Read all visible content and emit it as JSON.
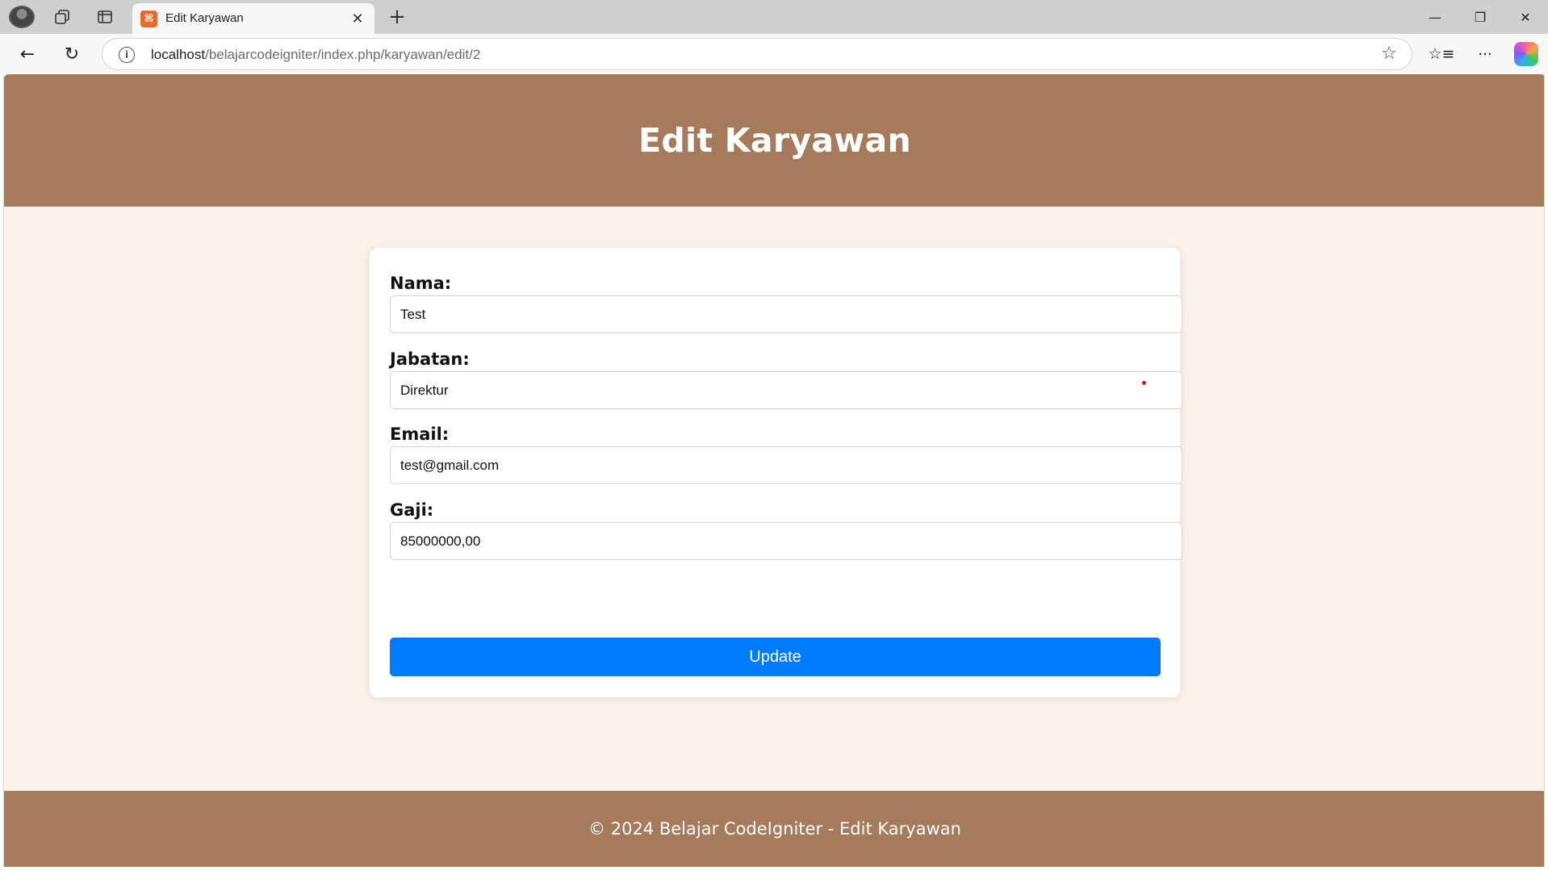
{
  "browser": {
    "tab_title": "Edit Karyawan",
    "tab_favicon_glyph": "⌘",
    "url_host": "localhost",
    "url_path": "/belajarcodeigniter/index.php/karyawan/edit/2",
    "icons": {
      "profile": "profile-avatar",
      "workspaces": "workspaces-icon",
      "tab_actions": "vertical-tabs-icon",
      "close_tab": "close-icon",
      "new_tab": "plus-icon",
      "minimize": "minimize-icon",
      "maximize": "restore-icon",
      "close_window": "close-icon",
      "back": "back-arrow-icon",
      "refresh": "refresh-icon",
      "site_info": "info-icon",
      "favorite": "star-icon",
      "favorites": "favorites-icon",
      "more": "more-icon",
      "copilot": "copilot-icon"
    },
    "glyphs": {
      "close": "✕",
      "plus": "+",
      "minimize": "—",
      "restore": "❐",
      "back": "←",
      "refresh": "↻",
      "info": "i",
      "star": "☆",
      "favorites": "☆≡",
      "more": "···"
    }
  },
  "page": {
    "title": "Edit Karyawan",
    "header_color": "#a67b5b",
    "background_color": "#fbf3ea",
    "accent_color": "#007bff"
  },
  "form": {
    "fields": [
      {
        "label": "Nama:",
        "value": "Test"
      },
      {
        "label": "Jabatan:",
        "value": "Direktur"
      },
      {
        "label": "Email:",
        "value": "test@gmail.com"
      },
      {
        "label": "Gaji:",
        "value": "85000000,00"
      }
    ],
    "submit_label": "Update"
  },
  "footer": {
    "text": "© 2024 Belajar CodeIgniter - Edit Karyawan"
  }
}
